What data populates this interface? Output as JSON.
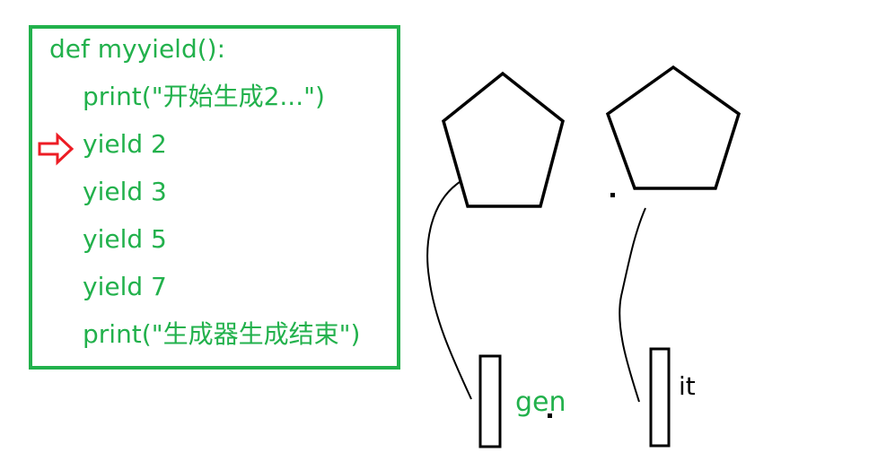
{
  "code": {
    "lines": [
      "def myyield():",
      "print(\"开始生成2...\")",
      "yield 2",
      "yield 3",
      "yield 5",
      "yield 7",
      "print(\"生成器生成结束\")"
    ],
    "current_line_index": 2
  },
  "labels": {
    "gen": "gen",
    "it": "it"
  },
  "colors": {
    "code_text": "#22b14c",
    "box_border": "#22b14c",
    "arrow": "#ed1c24",
    "drawing": "#000000",
    "gen_label": "#22b14c",
    "it_label": "#000000"
  }
}
